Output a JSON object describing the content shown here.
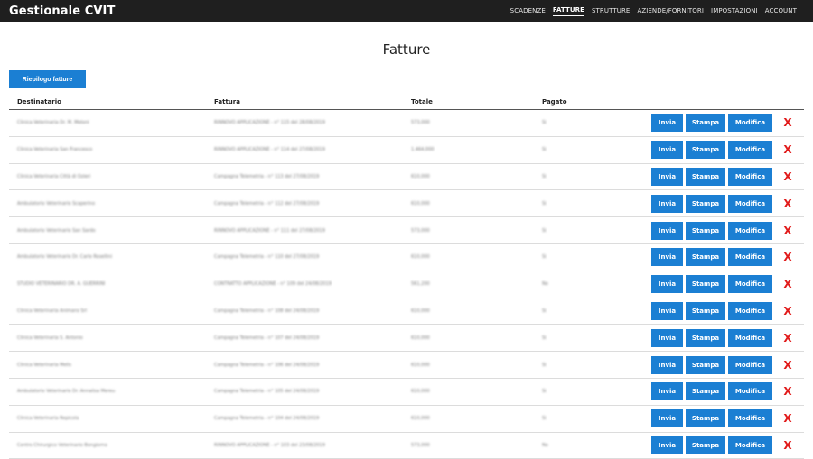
{
  "app": {
    "title": "Gestionale CVIT"
  },
  "nav": [
    {
      "label": "SCADENZE",
      "active": false
    },
    {
      "label": "FATTURE",
      "active": true
    },
    {
      "label": "STRUTTURE",
      "active": false
    },
    {
      "label": "AZIENDE/FORNITORI",
      "active": false
    },
    {
      "label": "IMPOSTAZIONI",
      "active": false
    },
    {
      "label": "ACCOUNT",
      "active": false
    }
  ],
  "page": {
    "title": "Fatture",
    "summary_button": "Riepilogo fatture"
  },
  "table": {
    "headers": {
      "destinatario": "Destinatario",
      "fattura": "Fattura",
      "totale": "Totale",
      "pagato": "Pagato"
    },
    "rows": [
      {
        "destinatario": "Clinica Veterinaria Dr. M. Meloni",
        "fattura": "RINNOVO APPLICAZIONE - n° 115 del 28/08/2019",
        "totale": "573,000",
        "pagato": "Si"
      },
      {
        "destinatario": "Clinica Veterinaria San Francesco",
        "fattura": "RINNOVO APPLICAZIONE - n° 114 del 27/08/2019",
        "totale": "1.464,000",
        "pagato": "Si"
      },
      {
        "destinatario": "Clinica Veterinaria Città di Ozieri",
        "fattura": "Campagna Telemetria - n° 113 del 27/08/2019",
        "totale": "610,000",
        "pagato": "Si"
      },
      {
        "destinatario": "Ambulatorio Veterinario Scaperino",
        "fattura": "Campagna Telemetria - n° 112 del 27/08/2019",
        "totale": "610,000",
        "pagato": "Si"
      },
      {
        "destinatario": "Ambulatorio Veterinario San Sardo",
        "fattura": "RINNOVO APPLICAZIONE - n° 111 del 27/08/2019",
        "totale": "573,000",
        "pagato": "Si"
      },
      {
        "destinatario": "Ambulatorio Veterinario Dr. Carlo Rosellini",
        "fattura": "Campagna Telemetria - n° 110 del 27/08/2019",
        "totale": "610,000",
        "pagato": "Si"
      },
      {
        "destinatario": "STUDIO VETERINARIO DR. A. GUERRINI",
        "fattura": "CONTRATTO APPLICAZIONE - n° 109 del 24/08/2019",
        "totale": "561,200",
        "pagato": "No"
      },
      {
        "destinatario": "Clinica Veterinaria Animans Srl",
        "fattura": "Campagna Telemetria - n° 108 del 24/08/2019",
        "totale": "610,000",
        "pagato": "Si"
      },
      {
        "destinatario": "Clinica Veterinaria S. Antonio",
        "fattura": "Campagna Telemetria - n° 107 del 24/08/2019",
        "totale": "610,000",
        "pagato": "Si"
      },
      {
        "destinatario": "Clinica Veterinaria Melis",
        "fattura": "Campagna Telemetria - n° 106 del 24/08/2019",
        "totale": "610,000",
        "pagato": "Si"
      },
      {
        "destinatario": "Ambulatorio Veterinario Dr. Annalisa Mereu",
        "fattura": "Campagna Telemetria - n° 105 del 24/08/2019",
        "totale": "610,000",
        "pagato": "Si"
      },
      {
        "destinatario": "Clinica Veterinaria Repicola",
        "fattura": "Campagna Telemetria - n° 104 del 24/08/2019",
        "totale": "610,000",
        "pagato": "Si"
      },
      {
        "destinatario": "Centro Chirurgico Veterinario Bongiorno",
        "fattura": "RINNOVO APPLICAZIONE - n° 103 del 23/08/2019",
        "totale": "573,000",
        "pagato": "No"
      }
    ],
    "actions": {
      "invia": "Invia",
      "stampa": "Stampa",
      "modifica": "Modifica",
      "delete": "X"
    }
  },
  "colors": {
    "topbar": "#1f1f1f",
    "accent": "#1b7fd3",
    "delete": "#e11b1b"
  }
}
